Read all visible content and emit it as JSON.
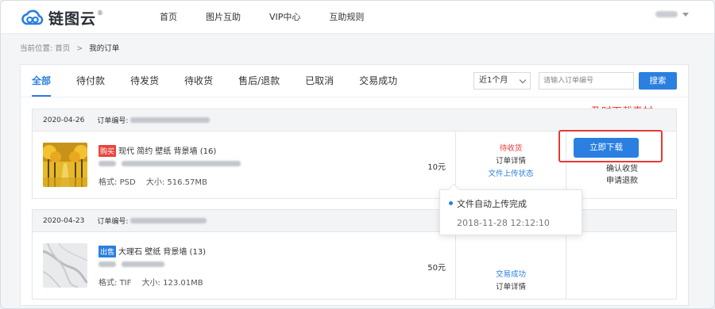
{
  "brand": {
    "name": "链图云",
    "registered": "®"
  },
  "nav": [
    "首页",
    "图片互助",
    "VIP中心",
    "互助规则"
  ],
  "breadcrumb": {
    "prefix": "当前位置:",
    "home": "首页",
    "separator": ">",
    "current": "我的订单"
  },
  "tabs": [
    "全部",
    "待付款",
    "待发货",
    "待收货",
    "售后/退款",
    "已取消",
    "交易成功"
  ],
  "filter": {
    "period": "近1个月",
    "search_placeholder": "请输入订单编号",
    "search_button": "搜索"
  },
  "hint": "及时下载素材",
  "orders": [
    {
      "date": "2020-04-26",
      "order_no_label": "订单编号:",
      "badge": "购买",
      "title": "现代 简约 壁纸 背景墙 (16)",
      "format_label": "格式:",
      "format": "PSD",
      "size_label": "大小:",
      "size": "516.57MB",
      "price": "10元",
      "status": "待收货",
      "status_link1": "订单详情",
      "status_link2": "文件上传状态",
      "action_button": "立即下载",
      "action1": "确认收货",
      "action2": "申请退款"
    },
    {
      "date": "2020-04-23",
      "order_no_label": "订单编号:",
      "badge": "出售",
      "title": "大理石 壁纸 背景墙 (13)",
      "format_label": "格式:",
      "format": "TIF",
      "size_label": "大小:",
      "size": "123.01MB",
      "price": "50元",
      "status": "交易成功",
      "status_link1": "订单详情"
    }
  ],
  "tooltip": {
    "message": "文件自动上传完成",
    "time": "2018-11-28 12:12:10"
  },
  "colors": {
    "accent": "#2a7fe0",
    "danger": "#e53935",
    "buy_badge": "#e8463f",
    "sell_badge": "#2a7fe0"
  }
}
